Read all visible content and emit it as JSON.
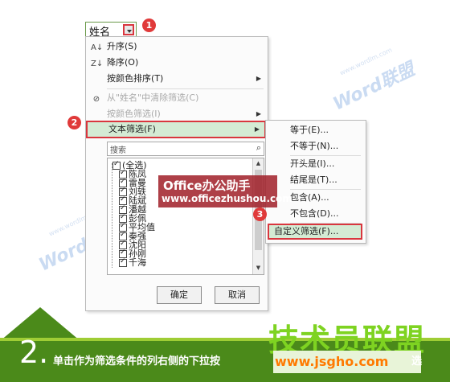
{
  "header_cell": {
    "text": "姓名"
  },
  "steps": {
    "one": "1",
    "two": "2",
    "three": "3"
  },
  "menu": {
    "sort_asc": "升序(S)",
    "sort_desc": "降序(O)",
    "sort_by_color": "按颜色排序(T)",
    "clear_filter": "从\"姓名\"中清除筛选(C)",
    "filter_by_color": "按颜色筛选(I)",
    "text_filter": "文本筛选(F)",
    "search_placeholder": "搜索",
    "items": [
      "(全选)",
      "陈凤",
      "雷曼",
      "刘轶",
      "陆斌",
      "潘越",
      "彭佩",
      "平均值",
      "秦强",
      "沈阳",
      "孙刚",
      "千海"
    ],
    "ok": "确定",
    "cancel": "取消"
  },
  "submenu": {
    "equals": "等于(E)...",
    "not_equals": "不等于(N)...",
    "begins_with": "开头是(I)...",
    "ends_with": "结尾是(T)...",
    "contains": "包含(A)...",
    "not_contains": "不包含(D)...",
    "custom": "自定义筛选(F)..."
  },
  "overlay": {
    "title": "Office办公助手",
    "url": "www.officezhushou.com"
  },
  "watermark": {
    "text": "Word联盟",
    "url": "www.wordlm.com"
  },
  "bottom": {
    "step_number": "2.",
    "instruction": "单击作为筛选条件的列右侧的下拉按",
    "tail": "选",
    "logo": "技术员联盟",
    "logo_url": "www.jsgho.com"
  },
  "colors": {
    "accent_red": "#d9363e",
    "band_green": "#4b8a1a",
    "logo_green": "#7ed321"
  }
}
